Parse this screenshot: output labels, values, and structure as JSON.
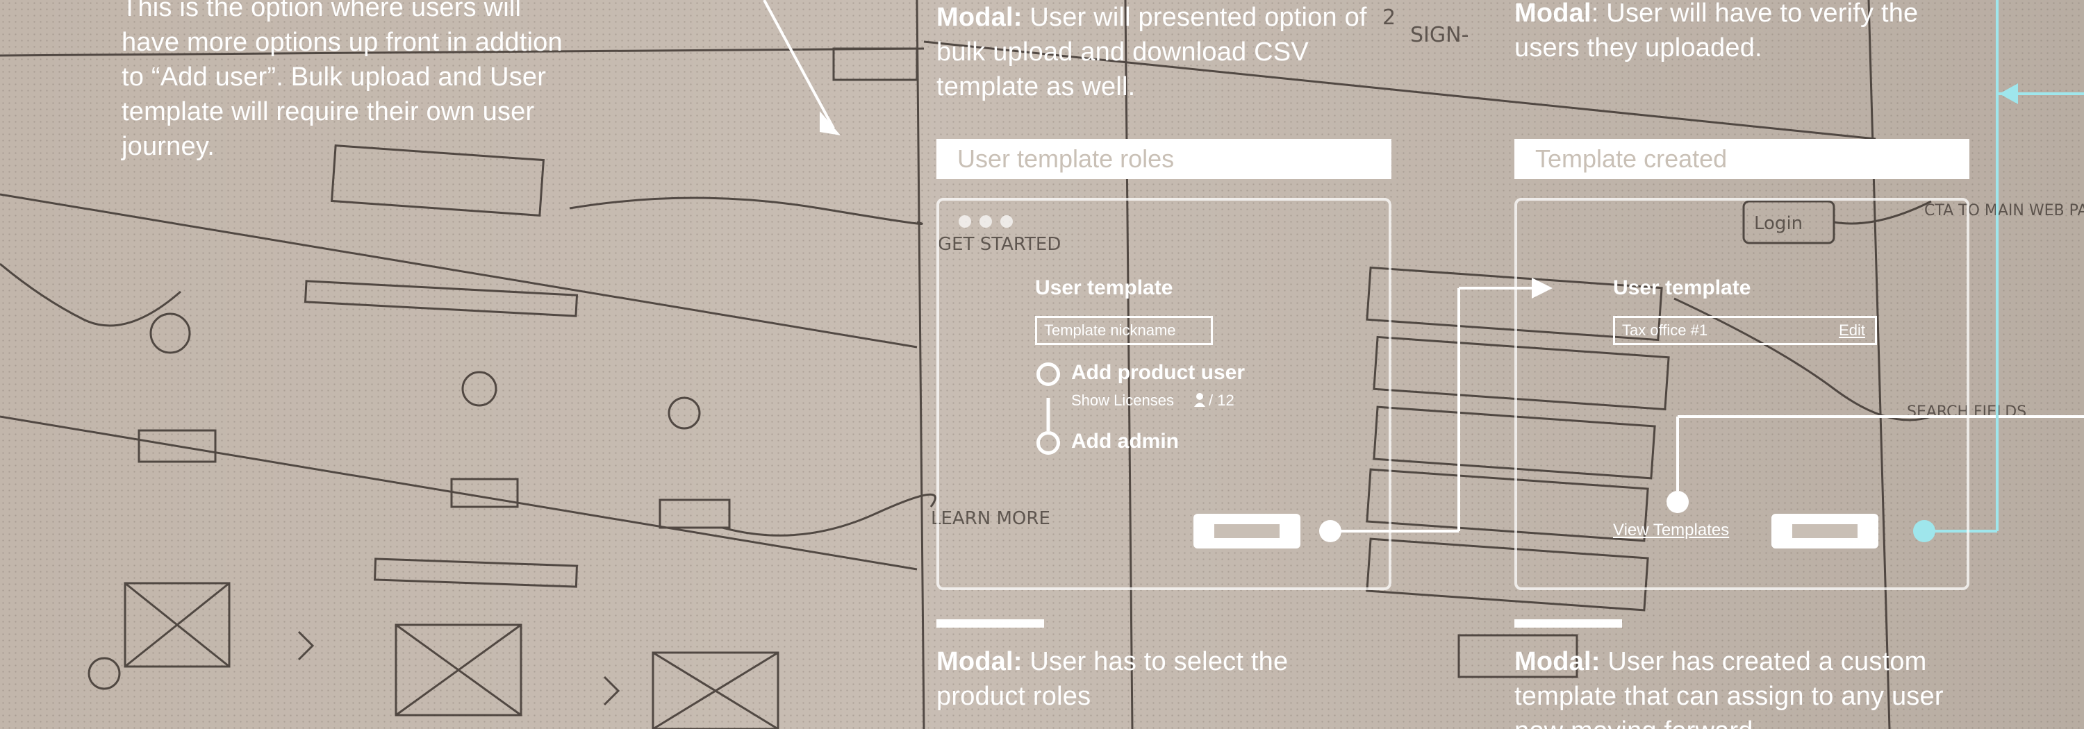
{
  "notes": {
    "top_left": "This is the option where users will have more options up front in addtion to “Add user”. Bulk upload and User template will require their own user journey.",
    "top_middle": {
      "bold": "Modal:",
      "text": " User will presented option of bulk upload and download CSV template as well."
    },
    "top_right": {
      "bold": "Modal",
      "text": ": User will have to verify the users they uploaded."
    },
    "bottom_middle": {
      "bold": "Modal:",
      "text": " User has to select the product roles"
    },
    "bottom_right": {
      "bold": "Modal:",
      "text": " User has created a custom template that can assign to any user now moving forward"
    }
  },
  "panel_roles": {
    "title_bar": "User template roles",
    "modal_title": "User template",
    "nickname_placeholder": "Template nickname",
    "step1_label": "Add product user",
    "step1_sub": "Show Licenses",
    "step1_count": "/ 12",
    "step2_label": "Add admin"
  },
  "panel_created": {
    "title_bar": "Template created",
    "modal_title": "User template",
    "nickname_value": "Tax office #1",
    "edit_label": "Edit",
    "view_link": "View Templates"
  },
  "sketch_text": {
    "step_label": "SIGN-",
    "get_started": "GET STARTED",
    "learn_more": "LEARN MORE",
    "login": "Login",
    "cta": "CTA TO MAIN WEB PAGE",
    "search_fields": "SEARCH FIELDS",
    "step_number": "2"
  },
  "colors": {
    "paper": "#c2b6ab",
    "annotation": "#ffffff",
    "accent_flow": "#9fe6ec"
  }
}
